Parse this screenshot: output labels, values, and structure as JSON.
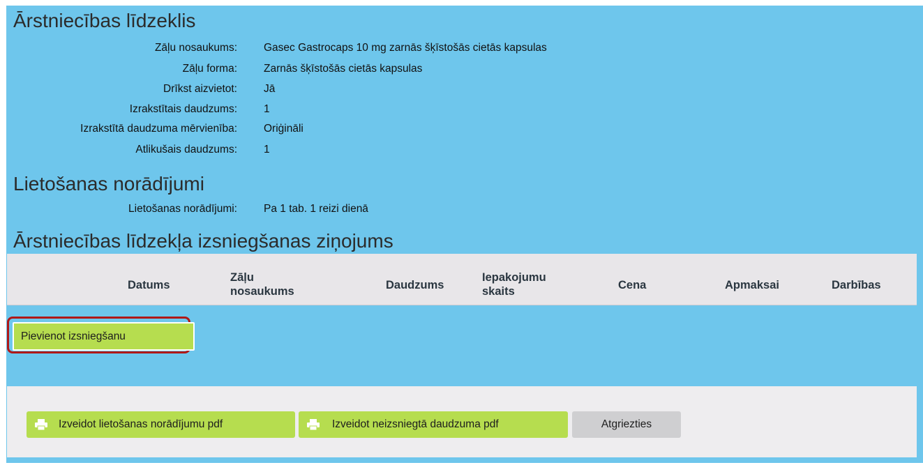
{
  "sections": {
    "medicine_title": "Ārstniecības līdzeklis",
    "usage_title": "Lietošanas norādījumi",
    "dispense_title": "Ārstniecības līdzekļa izsniegšanas ziņojums"
  },
  "medicine": {
    "name_label": "Zāļu nosaukums:",
    "name_value": "Gasec Gastrocaps 10 mg zarnās šķīstošās cietās kapsulas",
    "form_label": "Zāļu forma:",
    "form_value": "Zarnās šķīstošās cietās kapsulas",
    "replace_label": "Drīkst aizvietot:",
    "replace_value": "Jā",
    "qty_label": "Izrakstītais daudzums:",
    "qty_value": "1",
    "unit_label": "Izrakstītā daudzuma mērvienība:",
    "unit_value": "Oriģināli",
    "remaining_label": "Atlikušais daudzums:",
    "remaining_value": "1"
  },
  "usage": {
    "label": "Lietošanas norādījumi:",
    "value": "Pa 1 tab. 1 reizi dienā"
  },
  "table": {
    "headers": [
      "Datums",
      "Zāļu nosaukums",
      "Daudzums",
      "Iepakojumu skaits",
      "Cena",
      "Apmaksai",
      "Darbības"
    ]
  },
  "buttons": {
    "add_dispense": "Pievienot izsniegšanu",
    "usage_pdf": "Izveidot lietošanas norādījumu pdf",
    "undispensed_pdf": "Izveidot neizsniegtā daudzuma pdf",
    "back": "Atgriezties"
  },
  "icons": {
    "pdf_buttons": "printer-icon"
  }
}
